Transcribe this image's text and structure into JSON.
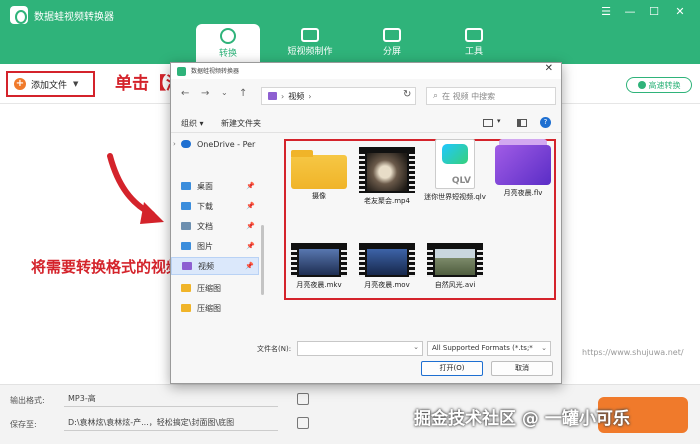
{
  "app": {
    "title": "数据蛙视频转换器",
    "tabs": [
      {
        "label": "转换",
        "active": true
      },
      {
        "label": "短视频制作",
        "active": false
      },
      {
        "label": "分屏",
        "active": false
      },
      {
        "label": "工具",
        "active": false
      }
    ],
    "window_controls": [
      "☰",
      "—",
      "☐",
      "✕"
    ]
  },
  "toolbar": {
    "add_file_label": "添加文件",
    "fast_convert_label": "高速转换"
  },
  "annotations": {
    "step1": "单击【添加文件】",
    "step2": "将需要转换格式的视频导入"
  },
  "watermarks": {
    "url": "https://www.shujuwa.net/",
    "site": "掘金技术社区 @ 一罐小可乐"
  },
  "bottom": {
    "format_label": "输出格式:",
    "format_value": "MP3-高",
    "save_label": "保存至:",
    "save_value": "D:\\袁林炫\\袁林炫-产...，轻松搞定\\封面图\\底图"
  },
  "dialog": {
    "title": "数据蛙视频转换器",
    "address": "视频",
    "address_chevron": "›",
    "search_placeholder": "在 视频 中搜索",
    "organize_label": "组织 ▾",
    "new_folder_label": "新建文件夹",
    "nav_items": [
      {
        "label": "OneDrive - Per",
        "pinned": false,
        "color": "#1e6fd1",
        "selected": false
      },
      {
        "label": "桌面",
        "pinned": true,
        "color": "#3b8ddc",
        "selected": false
      },
      {
        "label": "下载",
        "pinned": true,
        "color": "#3b8ddc",
        "selected": false
      },
      {
        "label": "文档",
        "pinned": true,
        "color": "#6d8faf",
        "selected": false
      },
      {
        "label": "图片",
        "pinned": true,
        "color": "#3b8ddc",
        "selected": false
      },
      {
        "label": "视频",
        "pinned": true,
        "color": "#8d5fd1",
        "selected": true
      },
      {
        "label": "压缩图",
        "pinned": false,
        "color": "#f0b429",
        "selected": false
      },
      {
        "label": "压缩图",
        "pinned": false,
        "color": "#f0b429",
        "selected": false
      }
    ],
    "files": [
      {
        "name": "摄像",
        "kind": "folder"
      },
      {
        "name": "老友聚会.mp4",
        "kind": "video",
        "tint": "#6b5a4a"
      },
      {
        "name": "迷你世界短视频.qlv",
        "kind": "qlv"
      },
      {
        "name": "月亮夜晨.flv",
        "kind": "flv"
      },
      {
        "name": "月亮夜晨.mkv",
        "kind": "video",
        "tint": "#3e5a8c"
      },
      {
        "name": "月亮夜晨.mov",
        "kind": "video",
        "tint": "#2b4a86"
      },
      {
        "name": "自然风光.avi",
        "kind": "video",
        "tint": "#7c8a6a"
      }
    ],
    "qlv_text": "QLV",
    "filename_label": "文件名(N):",
    "filetype_value": "All Supported Formats (*.ts;*",
    "open_label": "打开(O)",
    "cancel_label": "取消"
  },
  "colors": {
    "brand": "#2fb37a",
    "annotation": "#d4232b",
    "accent_orange": "#f07a2b"
  }
}
